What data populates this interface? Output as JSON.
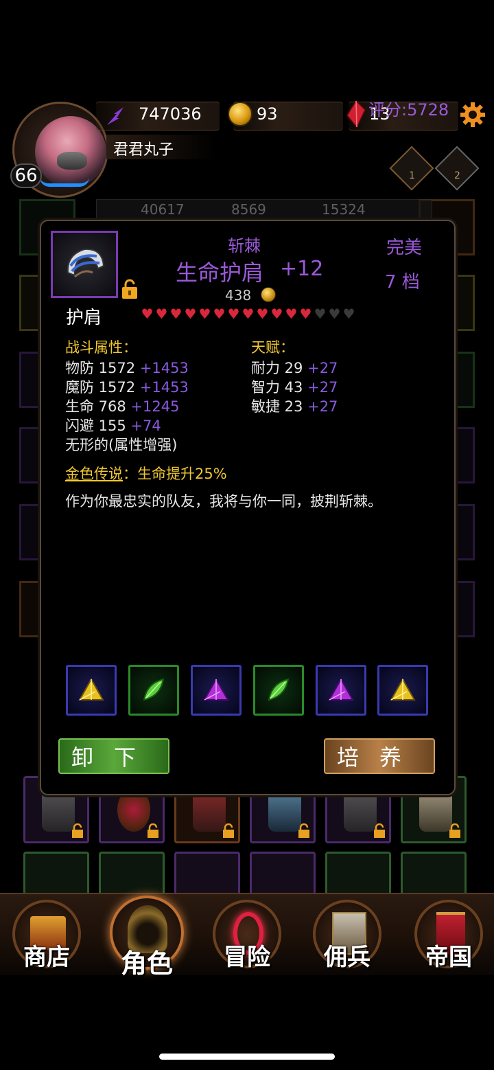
{
  "player": {
    "name": "君君丸子",
    "level": "66",
    "score": "评分:5728"
  },
  "resources": {
    "energy": "747036",
    "gold": "93",
    "gems": "13"
  },
  "ranks": [
    "1",
    "2"
  ],
  "background_strip": [
    "40617",
    "8569",
    "15324"
  ],
  "item": {
    "set_name": "斩棘",
    "name": "生命护肩",
    "enhance": "+12",
    "cost": "438",
    "quality": "完美",
    "tier": "7 档",
    "slot": "护肩",
    "hearts_filled": 12,
    "hearts_total": 15,
    "combat_label": "战斗属性：",
    "talent_label": "天赋：",
    "combat_stats": [
      {
        "name": "物防 1572",
        "bonus": "+1453"
      },
      {
        "name": "魔防 1572",
        "bonus": "+1453"
      },
      {
        "name": "生命 768",
        "bonus": "+1245"
      },
      {
        "name": "闪避 155",
        "bonus": "+74"
      }
    ],
    "affix": "无形的(属性增强)",
    "talent_stats": [
      {
        "name": "耐力 29",
        "bonus": "+27"
      },
      {
        "name": "智力 43",
        "bonus": "+27"
      },
      {
        "name": "敏捷 23",
        "bonus": "+27"
      }
    ],
    "legend_key": "金色传说",
    "legend_value": "：生命提升25%",
    "flavor": "作为你最忠实的队友，我将与你一同，披荆斩棘。",
    "gems": [
      "gold-crystal-icon",
      "green-leaf-icon",
      "purple-crystal-icon",
      "green-leaf-icon",
      "purple-crystal-icon",
      "gold-crystal-icon"
    ]
  },
  "buttons": {
    "unequip": "卸下",
    "train": "培养"
  },
  "nav": {
    "shop": "商店",
    "character": "角色",
    "adventure": "冒险",
    "mercenary": "佣兵",
    "empire": "帝国"
  },
  "colors": {
    "purple_text": "#9b59d8",
    "gold_text": "#f0c830",
    "heart_red": "#d8283a"
  }
}
